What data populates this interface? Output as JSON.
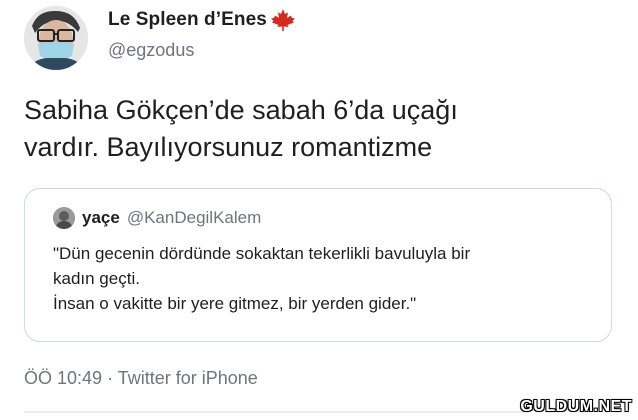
{
  "tweet": {
    "author": {
      "display_name": "Le Spleen d’Enes",
      "flag_icon": "maple-leaf-icon",
      "handle": "@egzodus"
    },
    "text_line1": "Sabiha Gökçen’de sabah 6’da uçağı",
    "text_line2": "vardır. Bayılıyorsunuz romantizme",
    "quote": {
      "author_name": "yaçe",
      "author_handle": "@KanDegilKalem",
      "line1": "\"Dün gecenin dördünde sokaktan tekerlikli bavuluyla bir",
      "line2": "kadın geçti.",
      "line3": "İnsan o vakitte bir yere gitmez, bir yerden gider.\""
    },
    "meta": {
      "time": "ÖÖ 10:49",
      "separator": "·",
      "source": "Twitter for iPhone"
    }
  },
  "watermark": "GULDUM.NET",
  "colors": {
    "text_primary": "#1f1f1f",
    "text_secondary": "#6e767d",
    "border": "#cfd9de",
    "flag_red": "#d52b1e"
  }
}
